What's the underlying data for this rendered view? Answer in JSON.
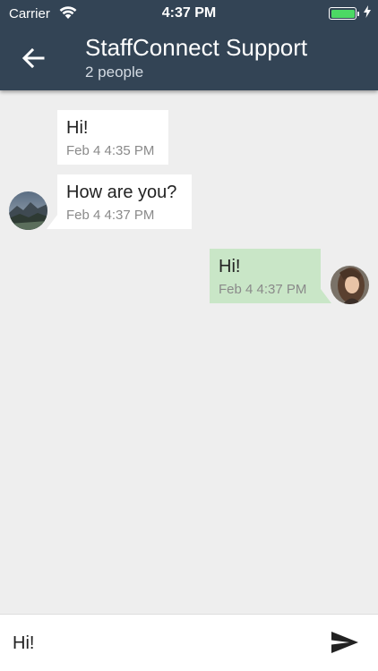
{
  "status_bar": {
    "carrier": "Carrier",
    "time": "4:37 PM",
    "battery_level": 1.0
  },
  "header": {
    "back_icon": "arrow-left-icon",
    "title": "StaffConnect Support",
    "subtitle": "2 people"
  },
  "messages": [
    {
      "sender": "other",
      "text": "Hi!",
      "time": "Feb 4 4:35 PM",
      "show_avatar": false
    },
    {
      "sender": "other",
      "text": "How are you?",
      "time": "Feb 4 4:37 PM",
      "show_avatar": true
    },
    {
      "sender": "me",
      "text": "Hi!",
      "time": "Feb 4 4:37 PM",
      "show_avatar": true
    }
  ],
  "composer": {
    "value": "Hi!",
    "send_icon": "send-icon"
  },
  "colors": {
    "header_bg": "#334455",
    "chat_bg": "#eeeeee",
    "incoming_bubble": "#ffffff",
    "outgoing_bubble": "#c9e6c7",
    "battery_fill": "#4cd964"
  }
}
